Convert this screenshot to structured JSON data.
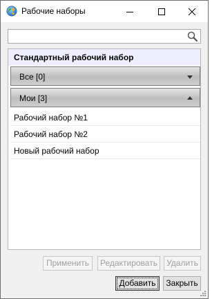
{
  "window": {
    "title": "Рабочие наборы",
    "icon": "globe-icon"
  },
  "search": {
    "value": "",
    "placeholder": "",
    "icon": "search-icon"
  },
  "list": {
    "standard_header": "Стандартный рабочий набор",
    "groups": [
      {
        "label": "Все [0]",
        "expanded": false
      },
      {
        "label": "Мои [3]",
        "expanded": true
      }
    ],
    "items": [
      "Рабочий набор №1",
      "Рабочий набор №2",
      "Новый рабочий набор"
    ]
  },
  "buttons": {
    "apply": "Применить",
    "edit": "Редактировать",
    "delete": "Удалить",
    "add": "Добавить",
    "close": "Закрыть"
  },
  "colors": {
    "standard_row_bg": "#eeeeff",
    "window_bg": "#f0f0f0",
    "disabled_text": "#a0a0a0"
  }
}
